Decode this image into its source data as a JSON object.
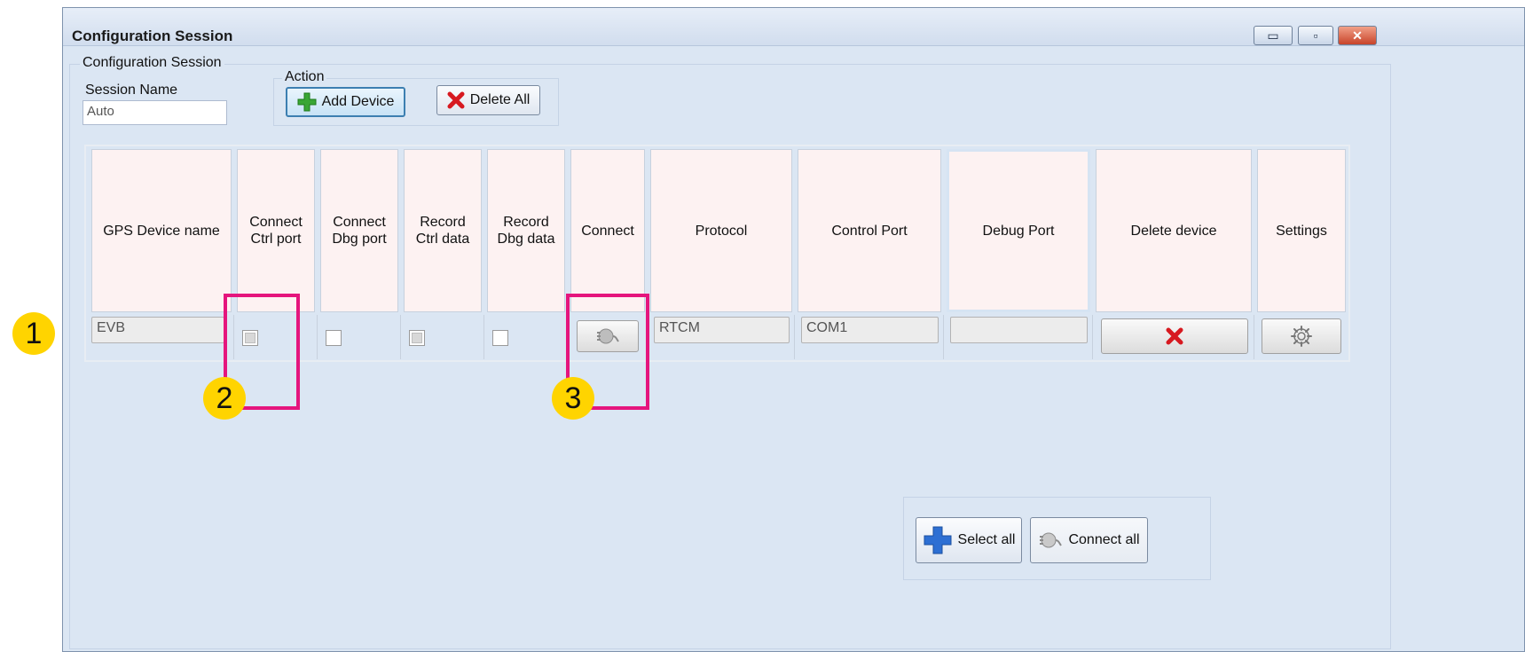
{
  "window": {
    "title": "Configuration Session",
    "controls": {
      "minimize": "▭",
      "maximize": "▫",
      "close": "✕"
    }
  },
  "config_group": {
    "legend": "Configuration Session",
    "session_name_label": "Session Name",
    "session_name_value": "Auto"
  },
  "action_group": {
    "legend": "Action",
    "add_device_label": "Add Device",
    "delete_all_label": "Delete All"
  },
  "device_table": {
    "headers": [
      "GPS Device name",
      "Connect\nCtrl port",
      "Connect\nDbg port",
      "Record\nCtrl data",
      "Record\nDbg data",
      "Connect",
      "Protocol",
      "Control Port",
      "Debug Port",
      "Delete device",
      "Settings"
    ],
    "rows": [
      {
        "device_name": "EVB",
        "connect_ctrl_port": false,
        "connect_dbg_port": false,
        "record_ctrl_data": false,
        "record_dbg_data": false,
        "protocol": "RTCM",
        "control_port": "COM1",
        "debug_port": ""
      }
    ]
  },
  "bottom_actions": {
    "select_all_label": "Select all",
    "connect_all_label": "Connect all"
  },
  "callouts": [
    "1",
    "2",
    "3"
  ],
  "colors": {
    "callout": "#ffd400",
    "highlight": "#e5157d",
    "delete_red": "#d71920",
    "add_green": "#3aa635",
    "select_blue": "#2d6fd3"
  },
  "icons": {
    "add_device": "green-plus-icon",
    "delete_all": "red-x-icon",
    "connect": "connect-plug-icon",
    "delete_device": "red-x-icon",
    "settings": "gear-icon",
    "select_all": "blue-plus-icon",
    "connect_all": "connect-plug-icon"
  }
}
